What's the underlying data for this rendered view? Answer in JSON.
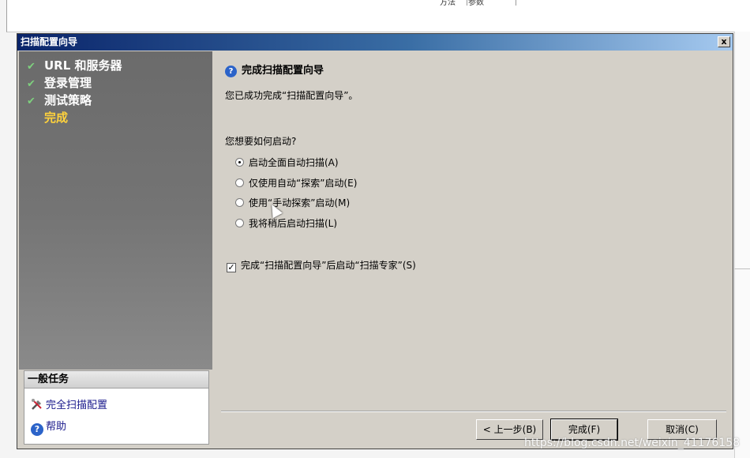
{
  "background_window": {
    "columns": [
      "方法",
      "参数"
    ]
  },
  "dialog": {
    "title": "扫描配置向导",
    "close_label": "x",
    "steps": [
      {
        "label": "URL 和服务器",
        "done": true
      },
      {
        "label": "登录管理",
        "done": true
      },
      {
        "label": "测试策略",
        "done": true
      },
      {
        "label": "完成",
        "done": false,
        "current": true
      }
    ],
    "tasks": {
      "header": "一般任务",
      "items": [
        {
          "label": "完全扫描配置",
          "icon": "tools-icon"
        },
        {
          "label": "帮助",
          "icon": "help-icon"
        }
      ]
    },
    "content": {
      "heading": "完成扫描配置向导",
      "success_text": "您已成功完成“扫描配置向导”。",
      "question": "您想要如何启动?",
      "options": [
        {
          "label": "启动全面自动扫描(A)",
          "selected": true
        },
        {
          "label": "仅使用自动“探索”启动(E)",
          "selected": false
        },
        {
          "label": "使用“手动探索”启动(M)",
          "selected": false
        },
        {
          "label": "我将稍后启动扫描(L)",
          "selected": false
        }
      ],
      "checkbox": {
        "label": "完成“扫描配置向导”后启动“扫描专家”(S)",
        "checked": true
      }
    },
    "buttons": {
      "back": "< 上一步(B)",
      "finish": "完成(F)",
      "cancel": "取消(C)"
    }
  },
  "watermark": "https://blog.csdn.net/weixin_41176158",
  "colors": {
    "titlebar_start": "#0a246a",
    "titlebar_end": "#a6caf0",
    "current_step": "#ffd23c",
    "dialog_face": "#d4d0c8"
  }
}
